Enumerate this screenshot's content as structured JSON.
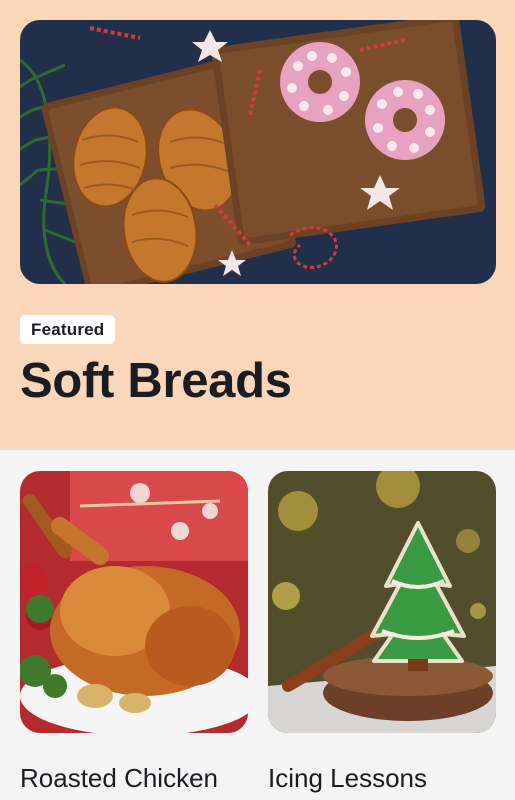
{
  "featured": {
    "badge": "Featured",
    "title": "Soft Breads",
    "image_icon": "breads-photo"
  },
  "cards": [
    {
      "label": "Roasted Chicken",
      "image_icon": "roasted-chicken-photo"
    },
    {
      "label": "Icing Lessons",
      "image_icon": "christmas-tree-cookie-photo"
    }
  ],
  "colors": {
    "featured_background": "#fcd6b9",
    "page_background": "#f4f4f4",
    "badge_background": "#ffffff",
    "text": "#1b1b22"
  }
}
